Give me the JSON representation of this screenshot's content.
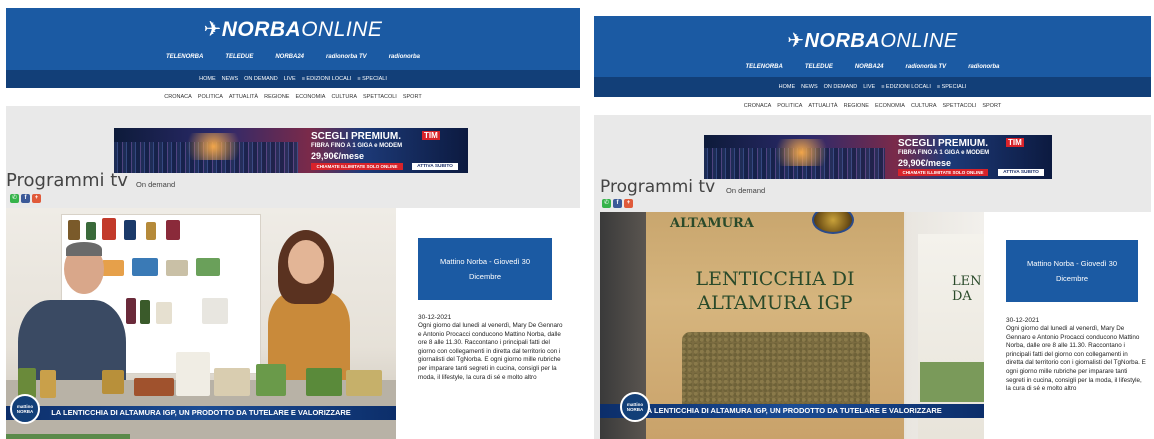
{
  "site": {
    "logo_prefix": "NORBA",
    "logo_suffix": "ONLINE",
    "channels": [
      "TELENORBA",
      "TELEDUE",
      "NORBA24",
      "radionorba TV",
      "radionorba"
    ],
    "nav_main": [
      "HOME",
      "NEWS",
      "ON DEMAND",
      "LIVE",
      "≡ EDIZIONI LOCALI",
      "≡ SPECIALI"
    ],
    "nav_sub": [
      "CRONACA",
      "POLITICA",
      "ATTUALITÀ",
      "REGIONE",
      "ECONOMIA",
      "CULTURA",
      "SPETTACOLI",
      "SPORT"
    ]
  },
  "banner": {
    "title": "SCEGLI PREMIUM.",
    "subtitle": "FIBRA FINO A 1 GIGA e MODEM",
    "price": "29,90€/mese",
    "strip": "CHIAMATE ILLIMITATE SOLO ONLINE",
    "cta": "ATTIVA SUBITO",
    "brand": "TIM"
  },
  "page": {
    "title": "Programmi tv",
    "breadcrumb": "On demand"
  },
  "video": {
    "caption": "LA LENTICCHIA DI ALTAMURA IGP, UN PRODOTTO DA TUTELARE E VALORIZZARE",
    "badge_line1": "mattino",
    "badge_line2": "NORBA",
    "bag_top": "ALTAMURA",
    "bag_line1": "LENTICCHIA DI",
    "bag_line2": "ALTAMURA IGP",
    "bag2_text": "LEN DA"
  },
  "episode": {
    "title": "Mattino Norba - Giovedì 30 Dicembre",
    "date": "30-12-2021",
    "description": "Ogni giorno dal lunedì al venerdì, Mary De Gennaro e Antonio Procacci conducono Mattino Norba, dalle ore 8 alle 11.30. Raccontano i principali fatti del giorno con collegamenti in diretta dal territorio con i giornalisti del TgNorba. E ogni giorno mille rubriche per imparare tanti segreti in cucina, consigli per la moda, il lifestyle, la cura di sé e molto altro"
  },
  "colors": {
    "header_blue": "#1b5aa3",
    "nav_dark_blue": "#123f78",
    "panel_gray": "#e9e9e9",
    "share_whatsapp": "#35b34a",
    "share_facebook": "#3b5998",
    "share_plus": "#e05a3a"
  },
  "icons": [
    "whatsapp-icon",
    "facebook-icon",
    "plus-icon"
  ]
}
